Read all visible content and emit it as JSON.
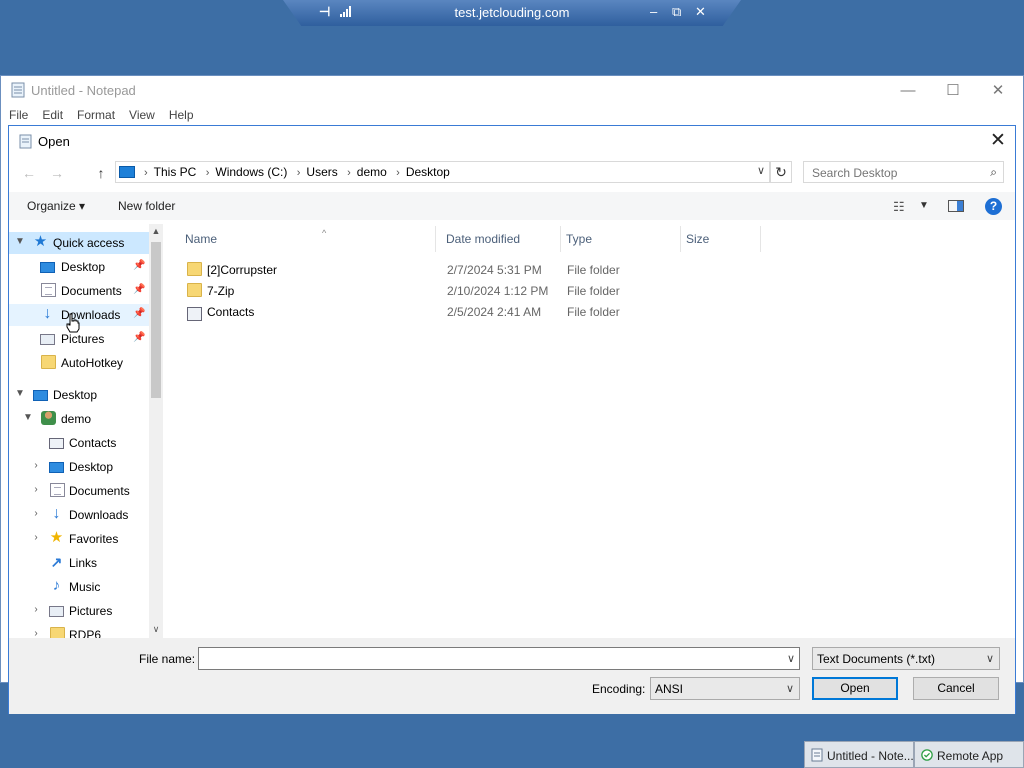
{
  "rdp_bar": {
    "host": "test.jetclouding.com",
    "pin_glyph": "⊣",
    "minimize_glyph": "–",
    "restore_glyph": "⧉",
    "close_glyph": "✕"
  },
  "notepad": {
    "title": "Untitled - Notepad",
    "menu": [
      "File",
      "Edit",
      "Format",
      "View",
      "Help"
    ],
    "minimize_glyph": "—",
    "maximize_glyph": "☐",
    "close_glyph": "✕"
  },
  "dialog": {
    "title": "Open",
    "close_glyph": "✕",
    "nav": {
      "back_glyph": "←",
      "forward_glyph": "→",
      "up_glyph": "↑",
      "refresh_glyph": "↻"
    },
    "breadcrumb": [
      "This PC",
      "Windows (C:)",
      "Users",
      "demo",
      "Desktop"
    ],
    "breadcrumb_sep": "›",
    "search_placeholder": "Search Desktop",
    "toolbar": {
      "organize": "Organize ▾",
      "new_folder": "New folder",
      "help": "?"
    },
    "navpane": {
      "quick_access": "Quick access",
      "quick_items": [
        {
          "label": "Desktop",
          "icon": "desktop-icon"
        },
        {
          "label": "Documents",
          "icon": "documents-icon"
        },
        {
          "label": "Downloads",
          "icon": "downloads-icon"
        },
        {
          "label": "Pictures",
          "icon": "pictures-icon"
        },
        {
          "label": "AutoHotkey",
          "icon": "folder-icon"
        }
      ],
      "desktop_root": "Desktop",
      "user": "demo",
      "user_items": [
        {
          "label": "Contacts",
          "icon": "contacts-icon"
        },
        {
          "label": "Desktop",
          "icon": "desktop-icon"
        },
        {
          "label": "Documents",
          "icon": "documents-icon"
        },
        {
          "label": "Downloads",
          "icon": "downloads-icon"
        },
        {
          "label": "Favorites",
          "icon": "favorites-icon"
        },
        {
          "label": "Links",
          "icon": "links-icon"
        },
        {
          "label": "Music",
          "icon": "music-icon"
        },
        {
          "label": "Pictures",
          "icon": "pictures-icon"
        },
        {
          "label": "RDP6",
          "icon": "folder-icon"
        }
      ]
    },
    "columns": [
      "Name",
      "Date modified",
      "Type",
      "Size"
    ],
    "files": [
      {
        "name": "[2]Corrupster",
        "date": "2/7/2024 5:31 PM",
        "type": "File folder",
        "icon": "folder-icon"
      },
      {
        "name": "7-Zip",
        "date": "2/10/2024 1:12 PM",
        "type": "File folder",
        "icon": "folder-icon"
      },
      {
        "name": "Contacts",
        "date": "2/5/2024 2:41 AM",
        "type": "File folder",
        "icon": "contacts-icon"
      }
    ],
    "file_name_label": "File name:",
    "file_name_value": "",
    "file_type": "Text Documents (*.txt)",
    "encoding_label": "Encoding:",
    "encoding": "ANSI",
    "open_label": "Open",
    "cancel_label": "Cancel"
  },
  "taskbar": [
    {
      "label": "Untitled - Note..."
    },
    {
      "label": "Remote App"
    }
  ],
  "colors": {
    "desktop_bg": "#3d6ea5",
    "selection": "#cce8ff",
    "accent": "#0078d7"
  }
}
